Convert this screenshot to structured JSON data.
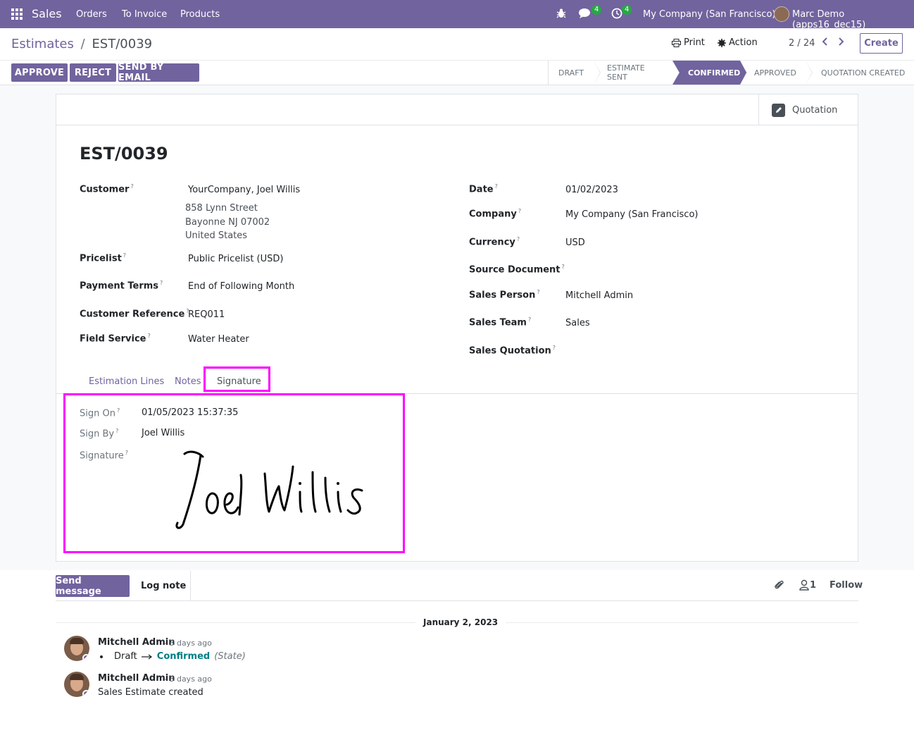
{
  "navbar": {
    "app_name": "Sales",
    "menu": [
      "Orders",
      "To Invoice",
      "Products"
    ],
    "messages_badge": "4",
    "activities_badge": "4",
    "company": "My Company (San Francisco)",
    "user": "Marc Demo (apps16_dec15)"
  },
  "breadcrumb": {
    "parent": "Estimates",
    "separator": "/",
    "current": "EST/0039"
  },
  "toolbar": {
    "print_label": "Print",
    "action_label": "Action",
    "pager": "2 / 24",
    "create_label": "Create"
  },
  "header_buttons": {
    "approve": "APPROVE",
    "reject": "REJECT",
    "send_by_email": "SEND BY EMAIL"
  },
  "statusbar": {
    "stages": [
      "DRAFT",
      "ESTIMATE SENT",
      "CONFIRMED",
      "APPROVED",
      "QUOTATION CREATED"
    ],
    "active": "CONFIRMED"
  },
  "smart_button": {
    "label": "Quotation",
    "icon": "pencil-square-icon"
  },
  "record": {
    "title": "EST/0039",
    "left_fields": {
      "customer_label": "Customer",
      "customer_name": "YourCompany, Joel Willis",
      "customer_address": [
        "858 Lynn Street",
        "Bayonne NJ 07002",
        "United States"
      ],
      "pricelist_label": "Pricelist",
      "pricelist": "Public Pricelist (USD)",
      "payment_terms_label": "Payment Terms",
      "payment_terms": "End of Following Month",
      "customer_ref_label": "Customer Reference",
      "customer_ref": "REQ011",
      "field_service_label": "Field Service",
      "field_service": "Water Heater"
    },
    "right_fields": {
      "date_label": "Date",
      "date": "01/02/2023",
      "company_label": "Company",
      "company": "My Company (San Francisco)",
      "currency_label": "Currency",
      "currency": "USD",
      "source_doc_label": "Source Document",
      "source_doc": "",
      "sales_person_label": "Sales Person",
      "sales_person": "Mitchell Admin",
      "sales_team_label": "Sales Team",
      "sales_team": "Sales",
      "sales_quotation_label": "Sales Quotation",
      "sales_quotation": ""
    },
    "help_marker": "?"
  },
  "tabs": [
    "Estimation Lines",
    "Notes",
    "Signature"
  ],
  "active_tab": "Signature",
  "signature_tab": {
    "sign_on_label": "Sign On",
    "sign_on": "01/05/2023 15:37:35",
    "sign_by_label": "Sign By",
    "sign_by": "Joel Willis",
    "signature_label": "Signature",
    "signature_text": "Joel Willis"
  },
  "chatter": {
    "send_message": "Send message",
    "log_note": "Log note",
    "followers_count": "1",
    "follow": "Follow",
    "date_separator": "January 2, 2023",
    "messages": [
      {
        "author": "Mitchell Admin",
        "date": "- 3 days ago",
        "tracking": {
          "old": "Draft",
          "new": "Confirmed",
          "field": "(State)"
        }
      },
      {
        "author": "Mitchell Admin",
        "date": "- 3 days ago",
        "body": "Sales Estimate created"
      }
    ]
  },
  "colors": {
    "brand": "#71639e",
    "highlight": "#ff00ff",
    "tracking_new": "#017e84"
  }
}
